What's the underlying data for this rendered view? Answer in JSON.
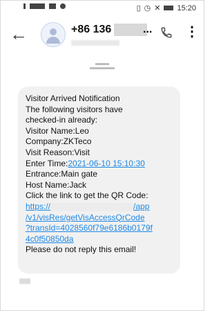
{
  "status_bar": {
    "time": "15:20"
  },
  "header": {
    "contact_prefix": "+86 136",
    "more_indicator": "...",
    "back_icon": "arrow-left-icon",
    "call_icon": "phone-icon",
    "menu_icon": "more-vertical-icon",
    "more_glyph": "⋮"
  },
  "message": {
    "title": "Visitor Arrived Notification",
    "line2": "The following visitors have",
    "line3": "checked-in already:",
    "visitor_name": "Visitor Name:Leo",
    "company": "Company:ZKTeco",
    "visit_reason": "Visit Reason:Visit",
    "enter_time_label": "Enter Time:",
    "enter_time_value": "2021-06-10 15:10:30",
    "entrance": "Entrance:Main gate",
    "host_name": "Host Name:Jack",
    "qr_prompt": "Click the link to get the QR Code:",
    "url_start": "https://",
    "url_line1_end": "/app",
    "url_line2": "/v1/visRes/getVisAccessQrCode",
    "url_line3": "?transId=4028560f79e6186b0179f",
    "url_line4": "4c0f50850da",
    "closing": "Please do not reply this email!"
  },
  "colors": {
    "link": "#1e88e5",
    "bubble": "#f1f1f1"
  }
}
